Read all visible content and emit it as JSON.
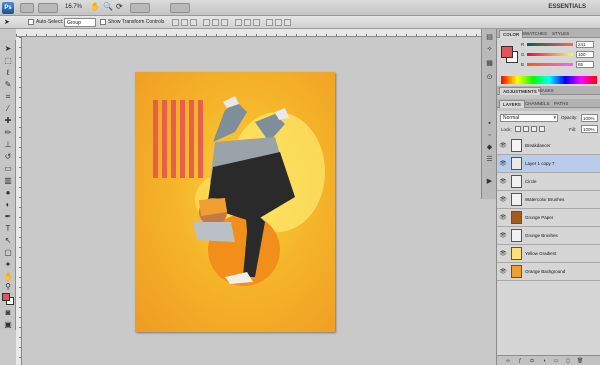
{
  "app": {
    "logo": "Ps",
    "zoom": "16.7%",
    "workspace": "ESSENTIALS"
  },
  "options": {
    "auto_select_label": "Auto-Select:",
    "auto_select_value": "Group",
    "show_transform_label": "Show Transform Controls"
  },
  "color_panel": {
    "tabs": [
      "COLOR",
      "SWATCHES",
      "STYLES"
    ],
    "channels": [
      {
        "label": "R",
        "value": "241"
      },
      {
        "label": "G",
        "value": "100"
      },
      {
        "label": "B",
        "value": "85"
      }
    ],
    "foreground": "#e05555"
  },
  "adjustments": {
    "tabs": [
      "ADJUSTMENTS",
      "MASKS"
    ]
  },
  "layers_panel": {
    "tabs": [
      "LAYERS",
      "CHANNELS",
      "PATHS"
    ],
    "blend_mode": "Normal",
    "opacity_label": "Opacity:",
    "opacity": "100%",
    "lock_label": "Lock:",
    "fill_label": "Fill:",
    "fill": "100%",
    "layers": [
      {
        "name": "Breakdancer",
        "thumb": "#f4f4f4"
      },
      {
        "name": "Layer 1 copy 7",
        "thumb": "#eaeaea"
      },
      {
        "name": "Circle",
        "thumb": "#f1f1f1"
      },
      {
        "name": "Watercolor Brushes",
        "thumb": "#f1f1f1"
      },
      {
        "name": "Grunge Paper",
        "thumb": "#a35a1e"
      },
      {
        "name": "Grunge Brushes",
        "thumb": "#f1f1f1"
      },
      {
        "name": "Yellow Gradient",
        "thumb": "#fbe07a"
      },
      {
        "name": "Orange Background",
        "thumb": "#f0a030"
      }
    ],
    "selected_index": 1
  }
}
